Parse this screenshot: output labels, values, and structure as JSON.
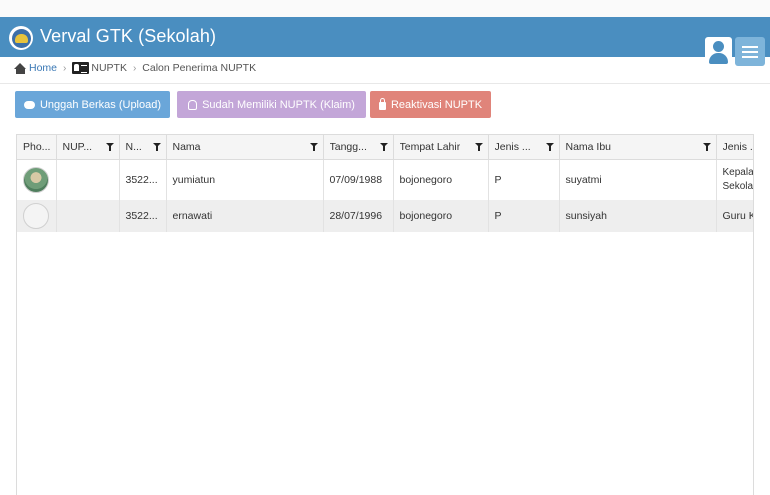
{
  "header": {
    "title": "Verval GTK (Sekolah)"
  },
  "breadcrumb": {
    "home": "Home",
    "section": "NUPTK",
    "current": "Calon Penerima NUPTK"
  },
  "actions": {
    "upload": "Unggah Berkas (Upload)",
    "claim": "Sudah Memiliki NUPTK (Klaim)",
    "reactivate": "Reaktivasi NUPTK"
  },
  "table": {
    "columns": [
      "Pho...",
      "NUP...",
      "N...",
      "Nama",
      "Tangg...",
      "Tempat Lahir",
      "Jenis ...",
      "Nama Ibu",
      "Jenis ..."
    ],
    "rows": [
      {
        "photo": "photo",
        "nuptk": "",
        "nik": "3522...",
        "nama": "yumiatun",
        "tanggal": "07/09/1988",
        "tempat": "bojonegoro",
        "jk": "P",
        "ibu": "suyatmi",
        "jenis": "Kepala Sekola"
      },
      {
        "photo": "empty",
        "nuptk": "",
        "nik": "3522...",
        "nama": "ernawati",
        "tanggal": "28/07/1996",
        "tempat": "bojonegoro",
        "jk": "P",
        "ibu": "sunsiyah",
        "jenis": "Guru K"
      }
    ]
  },
  "icons": {
    "logo": "tut-wuri-handayani-logo",
    "user": "user-icon",
    "menu": "hamburger-menu-icon",
    "home": "home-icon",
    "card": "id-card-icon",
    "upload": "cloud-upload-icon",
    "claim": "hand-pointer-icon",
    "reactivate": "unlock-icon",
    "filter": "filter-icon"
  },
  "colors": {
    "header": "#4a8ec0",
    "upload_btn": "#6aa6d9",
    "claim_btn": "#c3a6d8",
    "reactivate_btn": "#e0847a"
  }
}
